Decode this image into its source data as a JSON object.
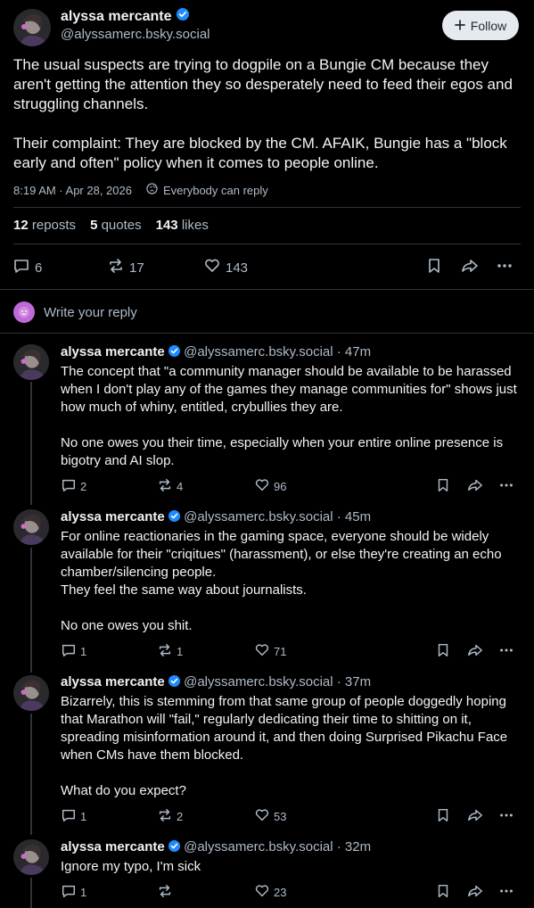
{
  "post": {
    "author_name": "alyssa mercante",
    "handle": "@alyssamerc.bsky.social",
    "follow_label": "Follow",
    "text": "The usual suspects are trying to dogpile on a Bungie CM because they aren't getting the attention they so desperately need to feed their egos and struggling channels.\n\nTheir complaint: They are blocked by the CM. AFAIK, Bungie has a \"block early and often\" policy when it comes to people online.",
    "timestamp": "8:19 AM · Apr 28, 2026",
    "reply_setting": "Everybody can reply",
    "stats": {
      "reposts_count": "12",
      "reposts_label": "reposts",
      "quotes_count": "5",
      "quotes_label": "quotes",
      "likes_count": "143",
      "likes_label": "likes"
    },
    "actions": {
      "replies": "6",
      "reposts": "17",
      "likes": "143"
    }
  },
  "reply_prompt": "Write your reply",
  "replies": [
    {
      "name": "alyssa mercante",
      "handle": "@alyssamerc.bsky.social",
      "time": "· 47m",
      "text": "The concept that \"a community manager should be available to be harassed when I don't play any of the games they manage communities for\" shows just how much of whiny, entitled, crybullies they are.\n\nNo one owes you their time, especially when your entire online presence is bigotry and AI slop.",
      "replies": "2",
      "reposts": "4",
      "likes": "96"
    },
    {
      "name": "alyssa mercante",
      "handle": "@alyssamerc.bsky.social",
      "time": "· 45m",
      "text": "For online reactionaries in the gaming space, everyone should be widely available for their \"criqitues\" (harassment), or else they're creating an echo chamber/silencing people.\nThey feel the same way about journalists.\n\nNo one owes you shit.",
      "replies": "1",
      "reposts": "1",
      "likes": "71"
    },
    {
      "name": "alyssa mercante",
      "handle": "@alyssamerc.bsky.social",
      "time": "· 37m",
      "text": "Bizarrely, this is stemming from that same group of people doggedly hoping that Marathon will \"fail,\" regularly dedicating their time to shitting on it, spreading misinformation around it, and then doing Surprised Pikachu Face when CMs have them blocked.\n\nWhat do you expect?",
      "replies": "1",
      "reposts": "2",
      "likes": "53"
    },
    {
      "name": "alyssa mercante",
      "handle": "@alyssamerc.bsky.social",
      "time": "· 32m",
      "text": "Ignore my typo, I'm sick",
      "replies": "1",
      "reposts": "",
      "likes": "23"
    }
  ],
  "colors": {
    "background": "#000000",
    "text": "#f1f3f5",
    "muted": "#aebbc9",
    "divider": "#2e3339",
    "verified": "#208bfe",
    "follow_bg": "#e6e9ed",
    "reply_avatar": "#c06ad8"
  },
  "icons": [
    "verified-badge-icon",
    "plus-icon",
    "globe-icon",
    "reply-icon",
    "repost-icon",
    "heart-icon",
    "bookmark-icon",
    "share-icon",
    "more-icon",
    "smiley-icon"
  ]
}
